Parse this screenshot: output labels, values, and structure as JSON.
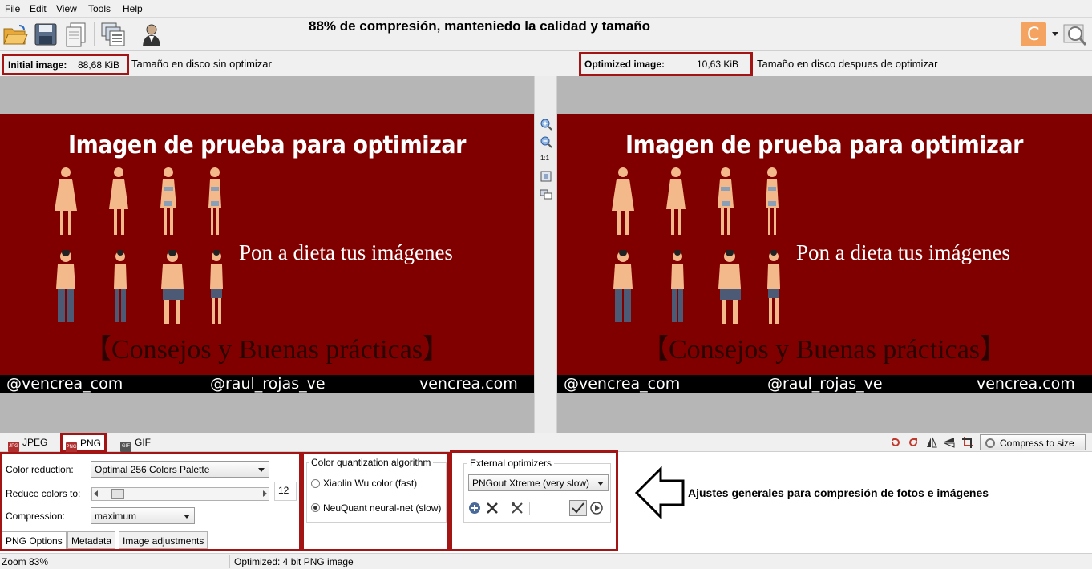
{
  "menu": {
    "items": [
      "File",
      "Edit",
      "View",
      "Tools",
      "Help"
    ]
  },
  "toolbar": {
    "headline": "88% de compresión, manteniedo la calidad y tamaño",
    "icons": [
      "open-folder-icon",
      "save-icon",
      "copy-icon",
      "batch-icon",
      "user-icon",
      "c-logo-icon",
      "zoom-settings-icon"
    ]
  },
  "info": {
    "initial_label": "Initial image:",
    "initial_value": "88,68 KiB",
    "initial_note": "Tamaño en disco sin optimizar",
    "optimized_label": "Optimized image:",
    "optimized_value": "10,63 KiB",
    "optimized_note": "Tamaño en disco despues de optimizar"
  },
  "preview": {
    "title": "Imagen de prueba para optimizar",
    "subtitle": "Pon a dieta tus imágenes",
    "advice": "【Consejos y Buenas prácticas】",
    "footer": [
      "@vencrea_com",
      "@raul_rojas_ve",
      "vencrea.com"
    ]
  },
  "zoom": {
    "one_to_one": "1:1"
  },
  "formats": {
    "tabs": [
      {
        "label": "JPEG",
        "icon": "JPG"
      },
      {
        "label": "PNG",
        "icon": "PNG"
      },
      {
        "label": "GIF",
        "icon": "GIF"
      }
    ],
    "compress_to_size": "Compress to size"
  },
  "png_options": {
    "color_reduction_label": "Color reduction:",
    "color_reduction_value": "Optimal 256 Colors Palette",
    "reduce_colors_label": "Reduce colors to:",
    "reduce_colors_value": "12",
    "compression_label": "Compression:",
    "compression_value": "maximum"
  },
  "quantization": {
    "title": "Color quantization algorithm",
    "option_1": "Xiaolin Wu color (fast)",
    "option_2": "NeuQuant neural-net (slow)",
    "selected": 2
  },
  "external": {
    "title": "External optimizers",
    "value": "PNGout Xtreme (very slow)"
  },
  "annotation": "Ajustes generales para compresión de fotos e imágenes",
  "subtabs": [
    "PNG Options",
    "Metadata",
    "Image adjustments"
  ],
  "status": {
    "zoom": "Zoom 83%",
    "optimized": "Optimized: 4 bit PNG image"
  },
  "colors": {
    "banner": "#800000",
    "highlight_box": "#a31515",
    "chrome": "#f0f0f0"
  }
}
